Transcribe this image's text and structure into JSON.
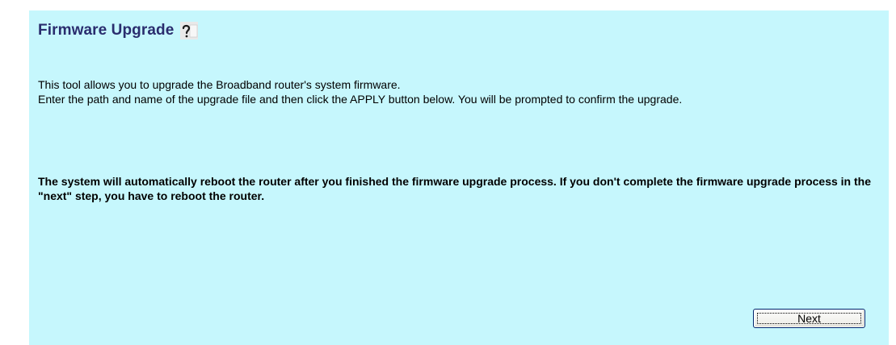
{
  "page": {
    "title": "Firmware Upgrade",
    "help_icon": "help-icon",
    "description_line1": "This tool allows you to upgrade the Broadband router's system firmware.",
    "description_line2": "Enter the path and name of the upgrade file and then click the APPLY button below. You will be prompted to confirm the upgrade.",
    "warning": "The system will automatically reboot the router after you finished the firmware upgrade process. If you don't complete the firmware upgrade process in the \"next\" step, you have to reboot the router."
  },
  "actions": {
    "next_label": "Next"
  },
  "colors": {
    "panel_background": "#c6f7fd",
    "title_color": "#2a2d6e"
  }
}
